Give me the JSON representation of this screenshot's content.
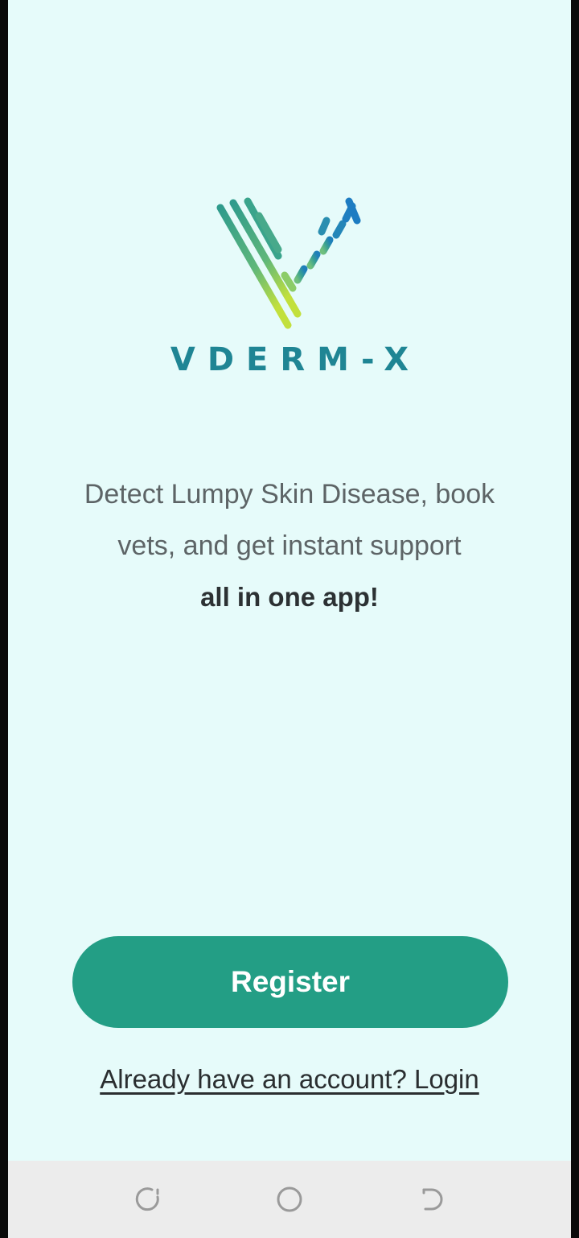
{
  "app": {
    "brand": "VDERM-X"
  },
  "intro": {
    "line1": "Detect Lumpy Skin Disease, book",
    "line2": "vets, and get instant support",
    "line3": "all in one app!"
  },
  "actions": {
    "register_label": "Register",
    "login_label": "Already have an account? Login"
  },
  "colors": {
    "background": "#e6fbfa",
    "accent": "#239e85",
    "brand_text": "#1f8594"
  },
  "navbar": {
    "buttons": [
      "recent-apps-icon",
      "home-icon",
      "back-icon"
    ]
  }
}
